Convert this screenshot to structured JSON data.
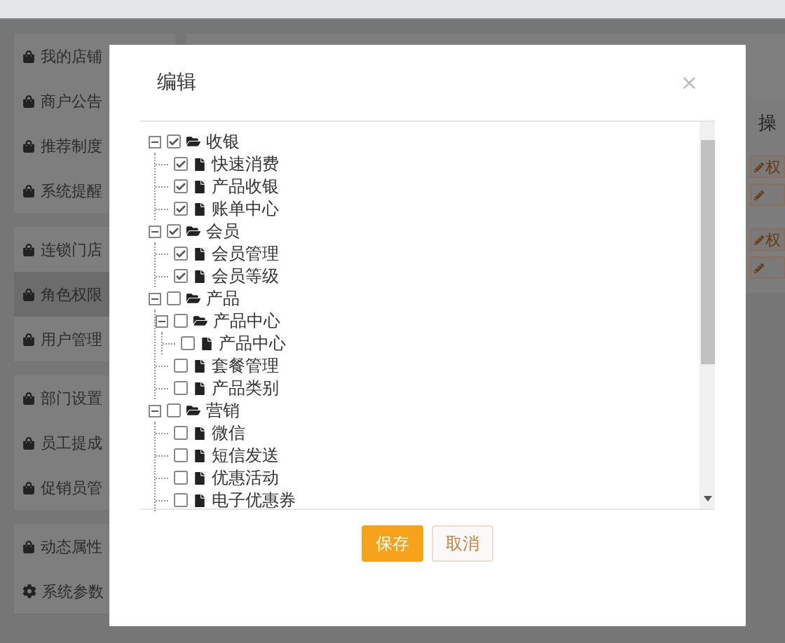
{
  "sidebar": {
    "groups": [
      {
        "items": [
          {
            "label": "我的店铺",
            "selected": false
          },
          {
            "label": "商户公告",
            "selected": false
          },
          {
            "label": "推荐制度",
            "selected": false
          },
          {
            "label": "系统提醒",
            "selected": false
          }
        ]
      },
      {
        "items": [
          {
            "label": "连锁门店",
            "selected": false
          },
          {
            "label": "角色权限",
            "selected": true
          },
          {
            "label": "用户管理",
            "selected": false
          }
        ]
      },
      {
        "items": [
          {
            "label": "部门设置",
            "selected": false
          },
          {
            "label": "员工提成",
            "selected": false
          },
          {
            "label": "促销员管",
            "selected": false
          }
        ]
      },
      {
        "items": [
          {
            "label": "动态属性",
            "selected": false
          },
          {
            "label": "系统参数",
            "selected": false
          }
        ]
      }
    ]
  },
  "table": {
    "column_1": "操",
    "rows": [
      {
        "button": "权"
      },
      {
        "button": "权"
      }
    ]
  },
  "dialog": {
    "title": "编辑",
    "close": "×",
    "tree": [
      {
        "label": "收银",
        "checked": true,
        "expanded": true,
        "children": [
          {
            "label": "快速消费",
            "checked": true
          },
          {
            "label": "产品收银",
            "checked": true
          },
          {
            "label": "账单中心",
            "checked": true
          }
        ]
      },
      {
        "label": "会员",
        "checked": true,
        "expanded": true,
        "children": [
          {
            "label": "会员管理",
            "checked": true
          },
          {
            "label": "会员等级",
            "checked": true
          }
        ]
      },
      {
        "label": "产品",
        "checked": false,
        "expanded": true,
        "children": [
          {
            "label": "产品中心",
            "checked": false,
            "expanded": true,
            "children": [
              {
                "label": "产品中心",
                "checked": false
              }
            ]
          },
          {
            "label": "套餐管理",
            "checked": false
          },
          {
            "label": "产品类别",
            "checked": false
          }
        ]
      },
      {
        "label": "营销",
        "checked": false,
        "expanded": true,
        "children": [
          {
            "label": "微信",
            "checked": false
          },
          {
            "label": "短信发送",
            "checked": false
          },
          {
            "label": "优惠活动",
            "checked": false
          },
          {
            "label": "电子优惠券",
            "checked": false
          }
        ]
      }
    ],
    "buttons": [
      {
        "label": "保存",
        "kind": "primary"
      },
      {
        "label": "取消",
        "kind": "secondary"
      }
    ]
  }
}
